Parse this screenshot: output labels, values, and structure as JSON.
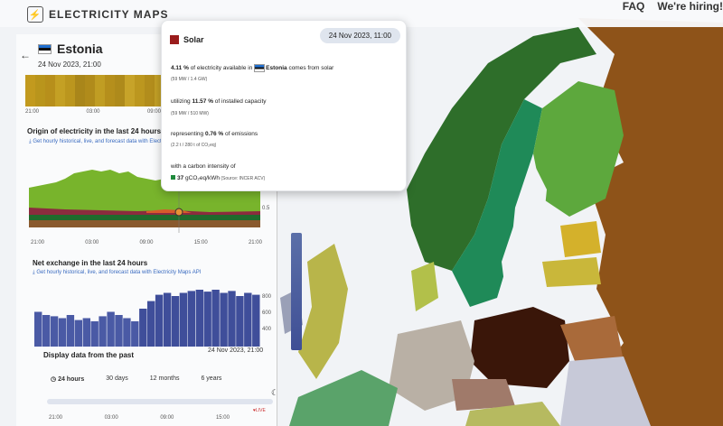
{
  "app": {
    "title": "ELECTRICITY MAPS",
    "faq": "FAQ",
    "hiring": "We're hiring!"
  },
  "zone": {
    "name": "Estonia",
    "date": "24 Nov 2023, 21:00"
  },
  "strip_ticks": [
    "21:00",
    "03:00",
    "09:00"
  ],
  "origin": {
    "title": "Origin of electricity in the last 24 hours",
    "link": "Get hourly historical, live, and forecast data with Electricity Maps API",
    "ticks": [
      "21:00",
      "03:00",
      "09:00",
      "15:00",
      "21:00"
    ],
    "right_tick": "0.5"
  },
  "exchange": {
    "title": "Net exchange in the last 24 hours",
    "link": "Get hourly historical, live, and forecast data with Electricity Maps API",
    "right_ticks": [
      "800",
      "600",
      "400"
    ],
    "values": [
      0.55,
      0.5,
      0.48,
      0.45,
      0.5,
      0.42,
      0.45,
      0.4,
      0.48,
      0.55,
      0.5,
      0.45,
      0.4,
      0.6,
      0.72,
      0.82,
      0.85,
      0.8,
      0.85,
      0.88,
      0.9,
      0.87,
      0.9,
      0.85,
      0.88,
      0.8,
      0.85,
      0.82
    ]
  },
  "past": {
    "title": "Display data from the past",
    "date": "24 Nov 2023, 21:00",
    "tabs": [
      "24 hours",
      "30 days",
      "12 months",
      "6 years"
    ],
    "ticks": [
      "21:00",
      "03:00",
      "09:00",
      "15:00"
    ],
    "live": "LIVE"
  },
  "tooltip": {
    "title": "Solar",
    "time": "24 Nov 2023, 11:00",
    "l1_pct": "4.11 %",
    "l1_mid": " of electricity available in ",
    "l1_zone": "Estonia",
    "l1_end": " comes from solar",
    "l1_sub": "(59 MW / 1.4 GW)",
    "l2_pre": "utilizing ",
    "l2_pct": "11.57 %",
    "l2_end": " of installed capacity",
    "l2_sub": "(59 MW / 510 MW)",
    "l3_pre": "representing ",
    "l3_pct": "0.76 %",
    "l3_end": " of emissions",
    "l3_sub": "(2.2 t / 280 t of CO₂eq)",
    "l4": "with a carbon intensity of",
    "l4_val": "37",
    "l4_unit": " gCO₂eq/kWh",
    "l4_src": " (Source: INCER ACV)"
  },
  "colors": {
    "solar": "#9a1c1c",
    "estonia_flag": [
      "#1f6fd0",
      "#111111",
      "#ffffff"
    ],
    "low_carbon": "#1f8a3c"
  }
}
